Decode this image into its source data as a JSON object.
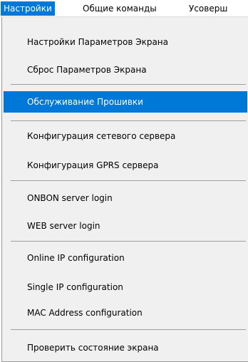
{
  "menubar": {
    "items": [
      {
        "label": "Настройки",
        "active": true
      },
      {
        "label": "Общие команды"
      },
      {
        "label": "Усоверш"
      }
    ]
  },
  "menu": {
    "items": [
      {
        "label": "Настройки Параметров Экрана"
      },
      {
        "label": "Сброс Параметров Экрана"
      },
      {
        "label": "Обслуживание Прошивки",
        "highlighted": true
      },
      {
        "label": "Конфигурация сетевого сервера"
      },
      {
        "label": "Конфигурация GPRS сервера"
      },
      {
        "label": "ONBON server login"
      },
      {
        "label": "WEB server login"
      },
      {
        "label": "Online IP configuration"
      },
      {
        "label": "Single IP configuration"
      },
      {
        "label": "MAC Address configuration"
      },
      {
        "label": "Проверить состояние экрана"
      }
    ]
  },
  "colors": {
    "highlight": "#0078d7",
    "menu_background": "#f0f0f0",
    "highlight_text": "#ffffff"
  }
}
